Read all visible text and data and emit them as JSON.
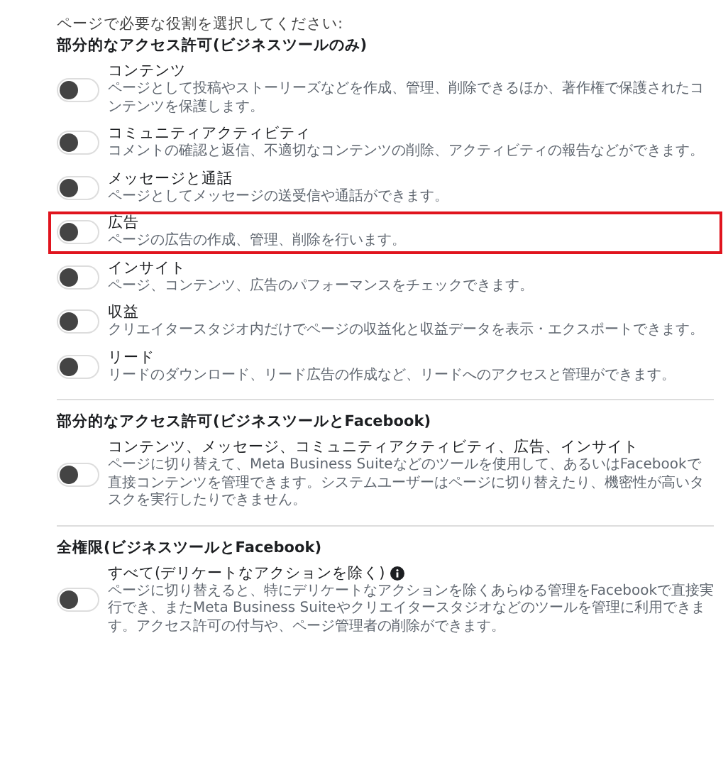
{
  "prompt": "ページで必要な役割を選択してください:",
  "sections": [
    {
      "title": "部分的なアクセス許可(ビジネスツールのみ)",
      "items": [
        {
          "name": "コンテンツ",
          "description": "ページとして投稿やストーリーズなどを作成、管理、削除できるほか、著作権で保護されたコンテンツを保護します。",
          "on": false,
          "highlighted": false,
          "info": false
        },
        {
          "name": "コミュニティアクティビティ",
          "description": "コメントの確認と返信、不適切なコンテンツの削除、アクティビティの報告などができます。",
          "on": false,
          "highlighted": false,
          "info": false
        },
        {
          "name": "メッセージと通話",
          "description": "ページとしてメッセージの送受信や通話ができます。",
          "on": false,
          "highlighted": false,
          "info": false
        },
        {
          "name": "広告",
          "description": "ページの広告の作成、管理、削除を行います。",
          "on": false,
          "highlighted": true,
          "info": false
        },
        {
          "name": "インサイト",
          "description": "ページ、コンテンツ、広告のパフォーマンスをチェックできます。",
          "on": false,
          "highlighted": false,
          "info": false
        },
        {
          "name": "収益",
          "description": "クリエイタースタジオ内だけでページの収益化と収益データを表示・エクスポートできます。",
          "on": false,
          "highlighted": false,
          "info": false
        },
        {
          "name": "リード",
          "description": "リードのダウンロード、リード広告の作成など、リードへのアクセスと管理ができます。",
          "on": false,
          "highlighted": false,
          "info": false
        }
      ]
    },
    {
      "title": "部分的なアクセス許可(ビジネスツールとFacebook)",
      "items": [
        {
          "name": "コンテンツ、メッセージ、コミュニティアクティビティ、広告、インサイト",
          "description": "ページに切り替えて、Meta Business Suiteなどのツールを使用して、あるいはFacebookで直接コンテンツを管理できます。システムユーザーはページに切り替えたり、機密性が高いタスクを実行したりできません。",
          "on": false,
          "highlighted": false,
          "info": false
        }
      ]
    },
    {
      "title": "全権限(ビジネスツールとFacebook)",
      "items": [
        {
          "name": "すべて(デリケートなアクションを除く)",
          "description": "ページに切り替えると、特にデリケートなアクションを除くあらゆる管理をFacebookで直接実行でき、またMeta Business Suiteやクリエイタースタジオなどのツールを管理に利用できます。アクセス許可の付与や、ページ管理者の削除ができます。",
          "on": false,
          "highlighted": false,
          "info": true
        }
      ]
    }
  ]
}
